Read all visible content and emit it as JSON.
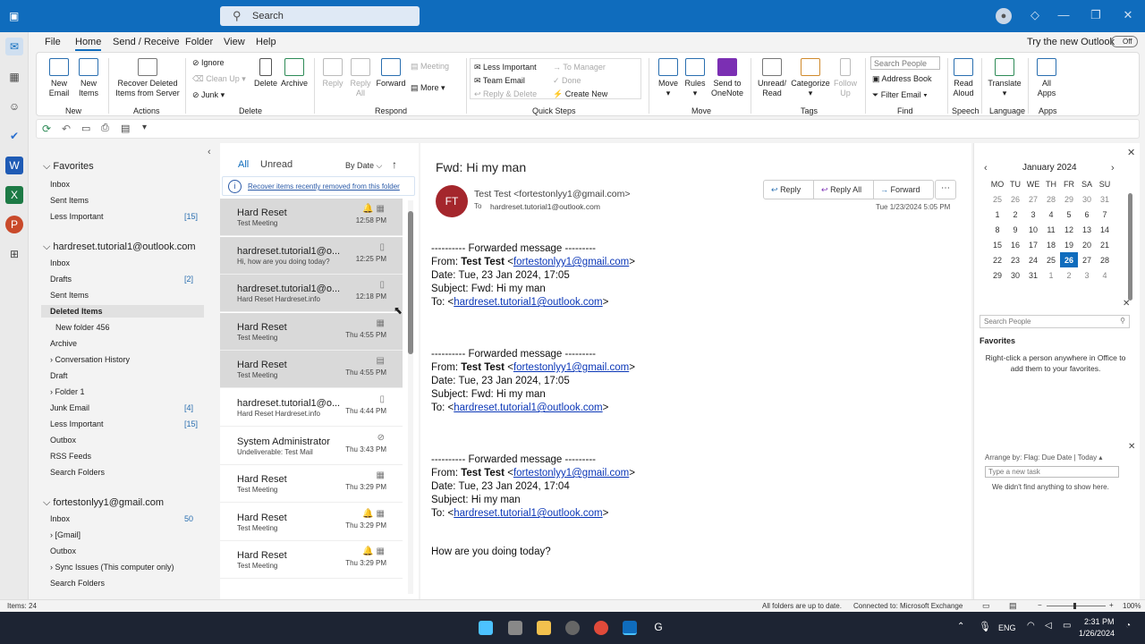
{
  "search": {
    "label": "Search"
  },
  "menu": [
    "File",
    "Home",
    "Send / Receive",
    "Folder",
    "View",
    "Help"
  ],
  "try_new": "Try the new Outlook",
  "toggle": "Off",
  "ribbon": {
    "new_email": "New\nEmail",
    "new_items": "New\nItems",
    "recover": "Recover Deleted\nItems from Server",
    "ignore": "Ignore",
    "cleanup": "Clean Up",
    "junk": "Junk",
    "delete": "Delete",
    "archive": "Archive",
    "reply": "Reply",
    "reply_all": "Reply\nAll",
    "forward": "Forward",
    "meeting": "Meeting",
    "more": "More",
    "qs1": "Less Important",
    "qs2": "Team Email",
    "qs3": "Reply & Delete",
    "qs4": "To Manager",
    "qs5": "Done",
    "qs6": "Create New",
    "move": "Move",
    "rules": "Rules",
    "send_onenote": "Send to\nOneNote",
    "unread_read": "Unread/\nRead",
    "categorize": "Categorize",
    "follow_up": "Follow\nUp",
    "search_people": "Search People",
    "address_book": "Address Book",
    "filter_email": "Filter Email",
    "read_aloud": "Read\nAloud",
    "translate": "Translate",
    "all_apps": "All\nApps",
    "groups": [
      "New",
      "Actions",
      "Delete",
      "Respond",
      "Quick Steps",
      "Move",
      "Tags",
      "Find",
      "Speech",
      "Language",
      "Apps"
    ]
  },
  "folders": {
    "favorites": "Favorites",
    "fav_items": [
      {
        "n": "Inbox",
        "c": ""
      },
      {
        "n": "Sent Items",
        "c": ""
      },
      {
        "n": "Less Important",
        "c": "[15]"
      }
    ],
    "acct1": "hardreset.tutorial1@outlook.com",
    "acct1_items": [
      {
        "n": "Inbox",
        "c": ""
      },
      {
        "n": "Drafts",
        "c": "[2]"
      },
      {
        "n": "Sent Items",
        "c": ""
      },
      {
        "n": "Deleted Items",
        "c": ""
      },
      {
        "n": "New folder 456",
        "c": ""
      },
      {
        "n": "Archive",
        "c": ""
      },
      {
        "n": "Conversation History",
        "c": ""
      },
      {
        "n": "Draft",
        "c": ""
      },
      {
        "n": "Folder 1",
        "c": ""
      },
      {
        "n": "Junk Email",
        "c": "[4]"
      },
      {
        "n": "Less Important",
        "c": "[15]"
      },
      {
        "n": "Outbox",
        "c": ""
      },
      {
        "n": "RSS Feeds",
        "c": ""
      },
      {
        "n": "Search Folders",
        "c": ""
      }
    ],
    "acct2": "fortestonlyy1@gmail.com",
    "acct2_items": [
      {
        "n": "Inbox",
        "c": "50"
      },
      {
        "n": "[Gmail]",
        "c": ""
      },
      {
        "n": "Outbox",
        "c": ""
      },
      {
        "n": "Sync Issues (This computer only)",
        "c": ""
      },
      {
        "n": "Search Folders",
        "c": ""
      }
    ]
  },
  "list": {
    "all": "All",
    "unread": "Unread",
    "sort": "By Date",
    "recover": "Recover items recently removed from this folder",
    "messages": [
      {
        "s": "Hard Reset",
        "p": "Test Meeting",
        "t": "12:58 PM"
      },
      {
        "s": "hardreset.tutorial1@o...",
        "p": "Hi, how are you doing today?",
        "t": "12:25 PM"
      },
      {
        "s": "hardreset.tutorial1@o...",
        "p": "Hard Reset  Hardreset.info",
        "t": "12:18 PM"
      },
      {
        "s": "Hard Reset",
        "p": "Test Meeting",
        "t": "Thu 4:55 PM"
      },
      {
        "s": "Hard Reset",
        "p": "Test Meeting",
        "t": "Thu 4:55 PM"
      },
      {
        "s": "hardreset.tutorial1@o...",
        "p": "Hard Reset  Hardreset.info",
        "t": "Thu 4:44 PM"
      },
      {
        "s": "System Administrator",
        "p": "Undeliverable: Test Mail",
        "t": "Thu 3:43 PM"
      },
      {
        "s": "Hard Reset",
        "p": "Test Meeting",
        "t": "Thu 3:29 PM"
      },
      {
        "s": "Hard Reset",
        "p": "Test Meeting",
        "t": "Thu 3:29 PM"
      },
      {
        "s": "Hard Reset",
        "p": "Test Meeting",
        "t": "Thu 3:29 PM"
      }
    ]
  },
  "reading": {
    "subject": "Fwd: Hi my man",
    "initials": "FT",
    "from": "Test Test <fortestonlyy1@gmail.com>",
    "to_label": "To",
    "to": "hardreset.tutorial1@outlook.com",
    "date": "Tue 1/23/2024 5:05 PM",
    "reply": "Reply",
    "reply_all": "Reply All",
    "forward": "Forward",
    "blocks": [
      {
        "sep": "---------- Forwarded message ---------",
        "from_pre": "From: ",
        "from_name": "Test Test",
        "from_mail": "fortestonlyy1@gmail.com",
        "date": "Date: Tue, 23 Jan 2024, 17:05",
        "subj": "Subject: Fwd: Hi my man",
        "to": "hardreset.tutorial1@outlook.com"
      },
      {
        "sep": "---------- Forwarded message ---------",
        "from_pre": "From: ",
        "from_name": "Test Test",
        "from_mail": "fortestonlyy1@gmail.com",
        "date": "Date: Tue, 23 Jan 2024, 17:05",
        "subj": "Subject: Fwd: Hi my man",
        "to": "hardreset.tutorial1@outlook.com"
      },
      {
        "sep": "---------- Forwarded message ---------",
        "from_pre": "From: ",
        "from_name": "Test Test",
        "from_mail": "fortestonlyy1@gmail.com",
        "date": "Date: Tue, 23 Jan 2024, 17:04",
        "subj": "Subject: Hi my man",
        "to": "hardreset.tutorial1@outlook.com"
      }
    ],
    "closing": "How are you doing today?"
  },
  "todo": {
    "month": "January 2024",
    "days": [
      "MO",
      "TU",
      "WE",
      "TH",
      "FR",
      "SA",
      "SU"
    ],
    "weeks": [
      [
        "25",
        "26",
        "27",
        "28",
        "29",
        "30",
        "31"
      ],
      [
        "1",
        "2",
        "3",
        "4",
        "5",
        "6",
        "7"
      ],
      [
        "8",
        "9",
        "10",
        "11",
        "12",
        "13",
        "14"
      ],
      [
        "15",
        "16",
        "17",
        "18",
        "19",
        "20",
        "21"
      ],
      [
        "22",
        "23",
        "24",
        "25",
        "26",
        "27",
        "28"
      ],
      [
        "29",
        "30",
        "31",
        "1",
        "2",
        "3",
        "4"
      ]
    ],
    "search_people": "Search People",
    "favorites": "Favorites",
    "fav_hint": "Right-click a person anywhere in Office to add them to your favorites.",
    "arrange": "Arrange by: Flag: Due Date",
    "today": "Today",
    "new_task": "Type a new task",
    "empty": "We didn't find anything to show here."
  },
  "status": {
    "items": "Items: 24",
    "sync": "All folders are up to date.",
    "connected": "Connected to: Microsoft Exchange",
    "zoom": "100%"
  },
  "taskbar": {
    "lang": "ENG",
    "time": "2:31 PM",
    "date": "1/26/2024"
  }
}
